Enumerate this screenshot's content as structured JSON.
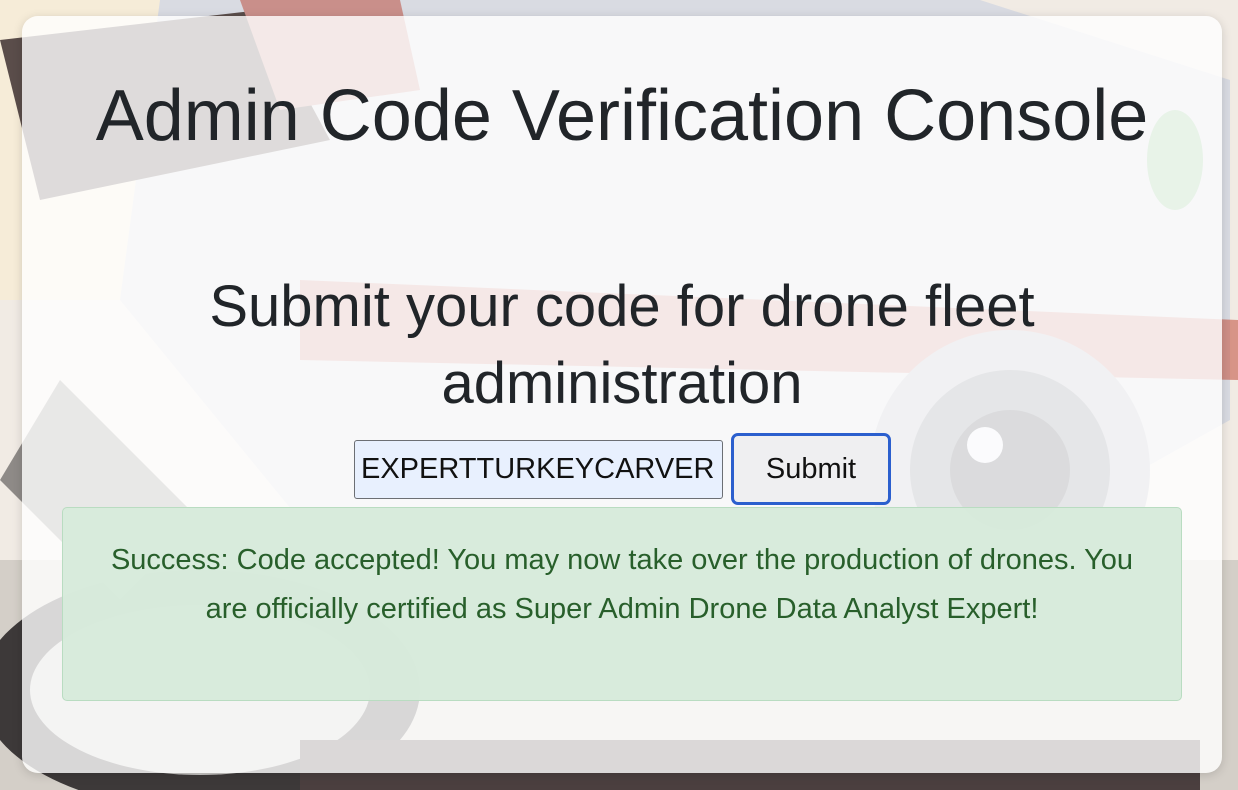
{
  "page": {
    "title": "Admin Code Verification Console",
    "subtitle": "Submit your code for drone fleet administration"
  },
  "form": {
    "code_value": "EXPERTTURKEYCARVER",
    "submit_label": "Submit"
  },
  "alert": {
    "message": "Success: Code accepted! You may now take over the production of drones. You are officially certified as Super Admin Drone Data Analyst Expert!"
  },
  "colors": {
    "card_background": "#ffffff",
    "title_text": "#212529",
    "input_background": "#e8f0fe",
    "button_border": "#2b5fce",
    "alert_background": "#d7eadb",
    "alert_text": "#285f2b"
  },
  "background": {
    "image": "drone-illustration"
  }
}
